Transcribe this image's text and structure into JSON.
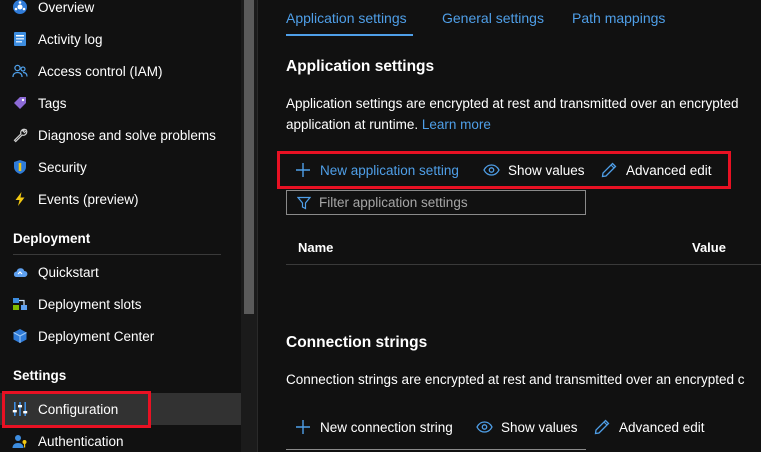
{
  "sidebar": {
    "items_top": [
      {
        "label": "Overview",
        "icon": "overview-icon"
      },
      {
        "label": "Activity log",
        "icon": "activity-log-icon"
      },
      {
        "label": "Access control (IAM)",
        "icon": "people-icon"
      },
      {
        "label": "Tags",
        "icon": "tag-icon"
      },
      {
        "label": "Diagnose and solve problems",
        "icon": "wrench-icon"
      },
      {
        "label": "Security",
        "icon": "shield-icon"
      },
      {
        "label": "Events (preview)",
        "icon": "lightning-icon"
      }
    ],
    "deployment": {
      "header": "Deployment",
      "items": [
        {
          "label": "Quickstart",
          "icon": "cloud-icon"
        },
        {
          "label": "Deployment slots",
          "icon": "slots-icon"
        },
        {
          "label": "Deployment Center",
          "icon": "cube-icon"
        }
      ]
    },
    "settings": {
      "header": "Settings",
      "items": [
        {
          "label": "Configuration",
          "icon": "sliders-icon",
          "selected": true
        },
        {
          "label": "Authentication",
          "icon": "user-key-icon"
        }
      ]
    }
  },
  "tabs": [
    {
      "label": "Application settings",
      "active": true
    },
    {
      "label": "General settings"
    },
    {
      "label": "Path mappings"
    }
  ],
  "app_settings": {
    "title": "Application settings",
    "desc_line1": "Application settings are encrypted at rest and transmitted over an encrypted",
    "desc_line2": "application at runtime.",
    "learn_more": "Learn more",
    "toolbar": {
      "new": "New application setting",
      "show": "Show values",
      "advanced": "Advanced edit"
    },
    "filter_placeholder": "Filter application settings",
    "columns": {
      "name": "Name",
      "value": "Value"
    }
  },
  "conn_strings": {
    "title": "Connection strings",
    "desc_line1": "Connection strings are encrypted at rest and transmitted over an encrypted c",
    "toolbar": {
      "new": "New connection string",
      "show": "Show values",
      "advanced": "Advanced edit"
    }
  },
  "colors": {
    "accent": "#4f9fe8",
    "highlight": "#e81123",
    "background": "#111111"
  }
}
